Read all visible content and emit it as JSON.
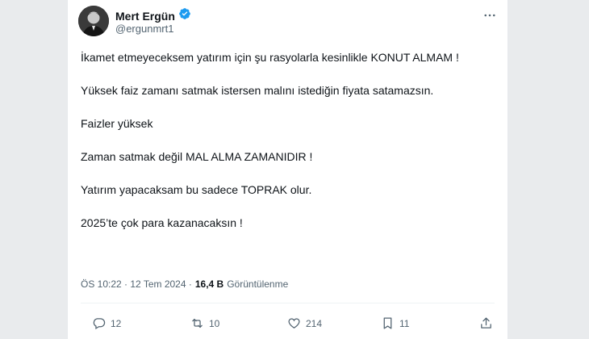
{
  "author": {
    "name": "Mert Ergün",
    "handle": "@ergunmrt1"
  },
  "tweet": {
    "lines": [
      "İkamet etmeyeceksem yatırım için şu rasyolarla kesinlikle KONUT ALMAM !",
      "Yüksek faiz zamanı satmak istersen malını istediğin fiyata satamazsın.",
      "Faizler yüksek",
      "Zaman satmak değil MAL ALMA ZAMANIDIR !",
      "Yatırım yapacaksam bu sadece TOPRAK olur.",
      "2025’te çok para kazanacaksın !"
    ],
    "timestamp": "ÖS 10:22 · 12 Tem 2024 ·",
    "views_count": "16,4 B",
    "views_label": "Görüntülenme"
  },
  "actions": {
    "replies": "12",
    "reposts": "10",
    "likes": "214",
    "bookmarks": "11"
  },
  "colors": {
    "text": "#0f1419",
    "secondary": "#536471",
    "verified": "#1d9bf0"
  }
}
